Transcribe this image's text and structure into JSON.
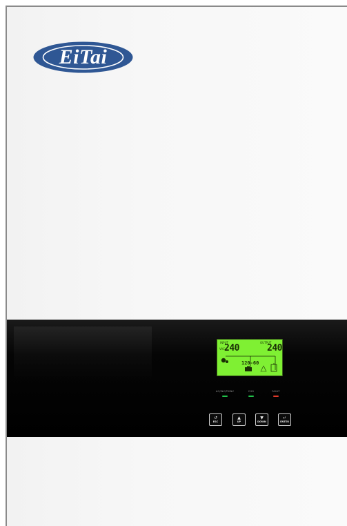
{
  "brand": {
    "logo_text": "EiTai",
    "logo_color": "#2f5794"
  },
  "lcd": {
    "backlight_color": "#7ff033",
    "input_label": "INPUT",
    "output_label": "OUTPUT",
    "input_value": "240",
    "output_value": "240",
    "unit": "VAC",
    "middle_value": "120-60"
  },
  "indicators": [
    {
      "label": "AC/INV/PVINV",
      "color": "#21c24a"
    },
    {
      "label": "CHG",
      "color": "#21c24a"
    },
    {
      "label": "FAULT",
      "color": "#e03a2a"
    }
  ],
  "buttons": {
    "esc": {
      "icon": "↺",
      "label": "ESC"
    },
    "up": {
      "icon": "▲",
      "label": "UP"
    },
    "down": {
      "icon": "▼",
      "label": "DOWN"
    },
    "enter": {
      "icon": "↵",
      "label": "ENTER"
    }
  }
}
